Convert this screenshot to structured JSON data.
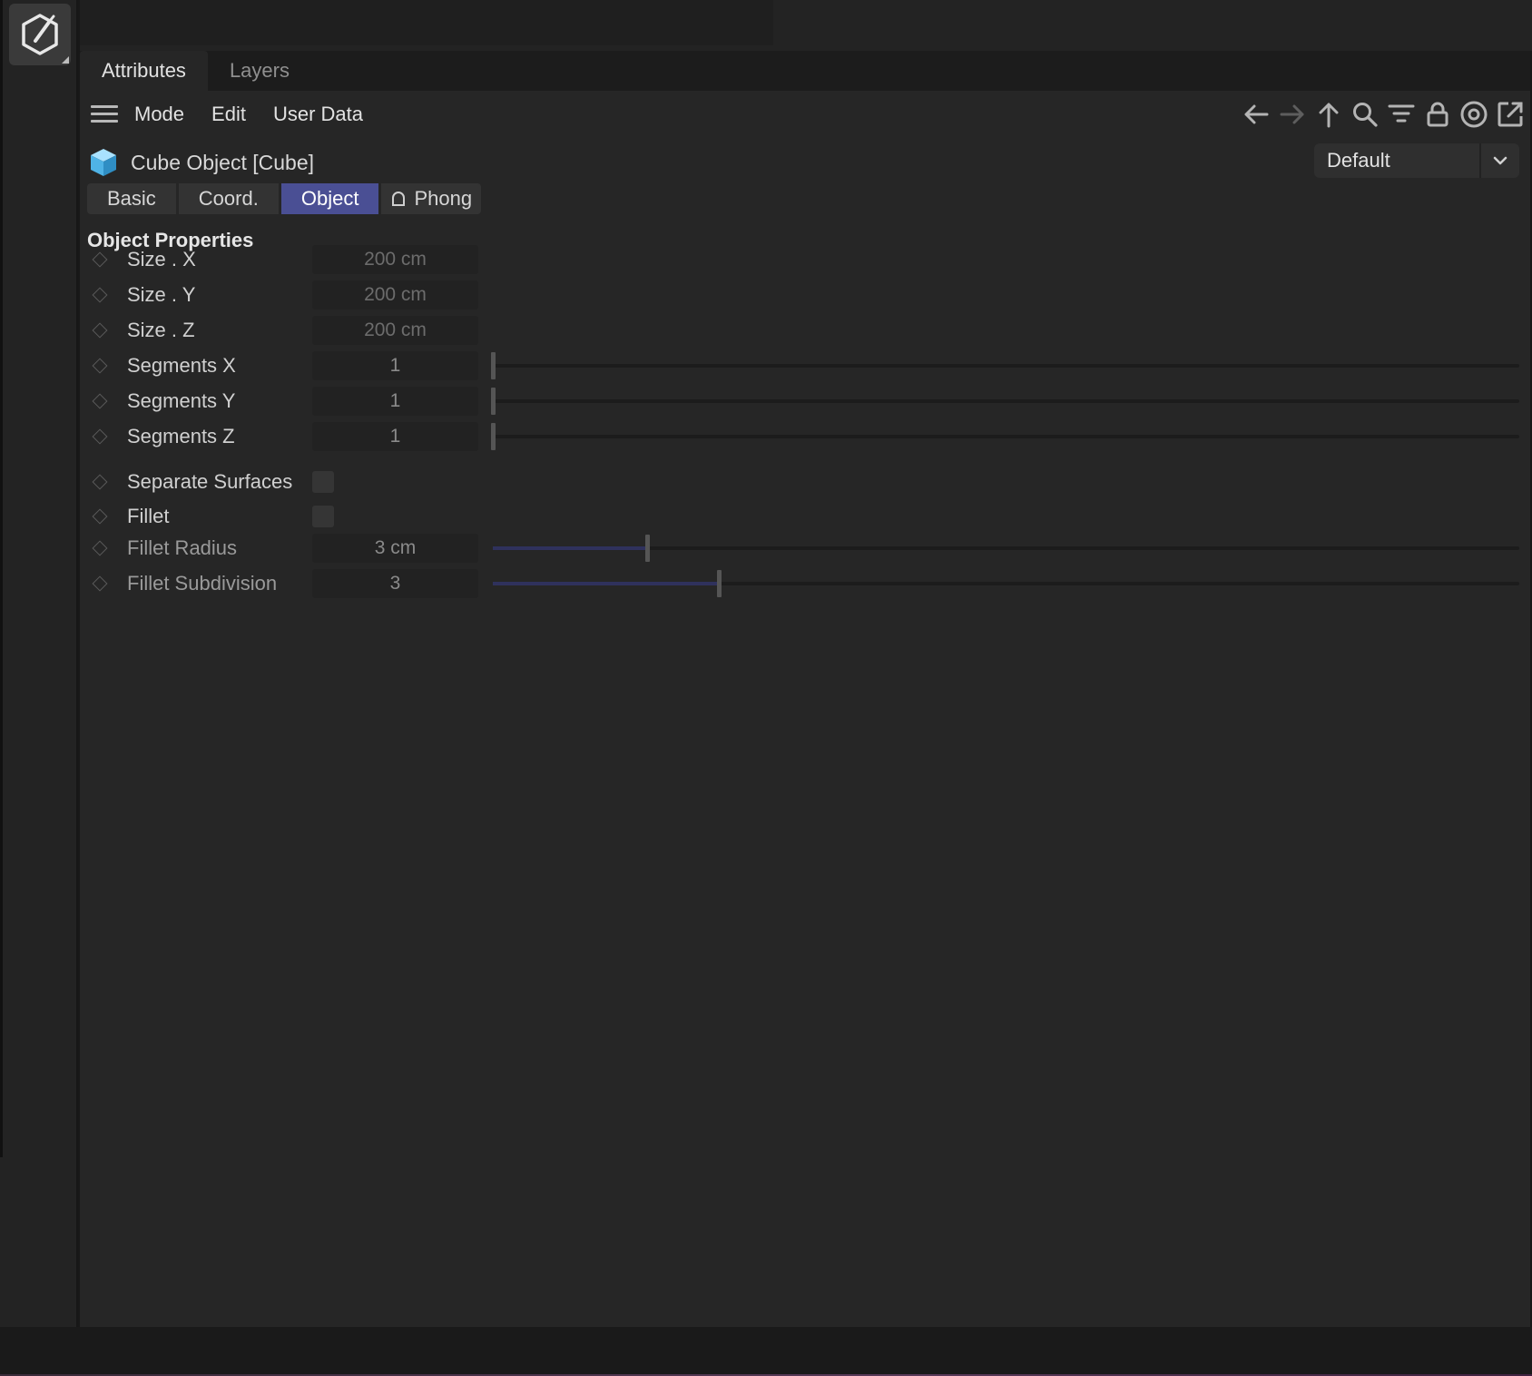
{
  "window": {
    "tabs": [
      {
        "label": "Attributes",
        "active": true
      },
      {
        "label": "Layers",
        "active": false
      }
    ]
  },
  "menu": {
    "items": [
      "Mode",
      "Edit",
      "User Data"
    ]
  },
  "toolbar": {
    "icons": [
      "back-arrow-icon",
      "forward-arrow-icon",
      "up-arrow-icon",
      "search-icon",
      "filter-icon",
      "lock-icon",
      "target-icon",
      "new-window-icon"
    ]
  },
  "object": {
    "icon": "cube-icon",
    "title": "Cube Object [Cube]",
    "preset": "Default"
  },
  "subtabs": [
    {
      "label": "Basic",
      "active": false
    },
    {
      "label": "Coord.",
      "active": false
    },
    {
      "label": "Object",
      "active": true
    },
    {
      "label": "Phong",
      "active": false,
      "icon": "bell-icon"
    }
  ],
  "section": {
    "title": "Object Properties"
  },
  "properties": {
    "size_x": {
      "label": "Size . X",
      "value": "200 cm"
    },
    "size_y": {
      "label": "Size . Y",
      "value": "200 cm"
    },
    "size_z": {
      "label": "Size . Z",
      "value": "200 cm"
    },
    "segments_x": {
      "label": "Segments X",
      "value": "1",
      "slider": 0.0
    },
    "segments_y": {
      "label": "Segments Y",
      "value": "1",
      "slider": 0.0
    },
    "segments_z": {
      "label": "Segments Z",
      "value": "1",
      "slider": 0.0
    },
    "separate_surfaces": {
      "label": "Separate Surfaces",
      "checked": false
    },
    "fillet": {
      "label": "Fillet",
      "checked": false
    },
    "fillet_radius": {
      "label": "Fillet Radius",
      "value": "3 cm",
      "slider": 0.15
    },
    "fillet_subdivision": {
      "label": "Fillet Subdivision",
      "value": "3",
      "slider": 0.22
    }
  },
  "colors": {
    "accent": "#4a4f94",
    "panel": "#262626",
    "cube_icon": "#6ec6f0"
  }
}
